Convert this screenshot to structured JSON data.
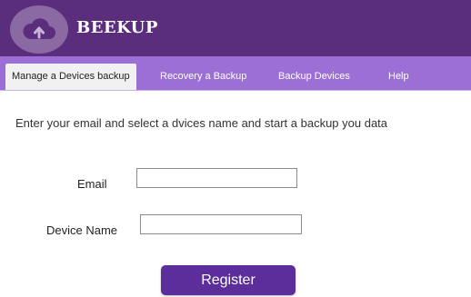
{
  "app": {
    "brand": "BEEKUP",
    "logo_icon": "cloud-upload-icon"
  },
  "tabs": [
    {
      "label": "Manage a Devices backup",
      "active": true
    },
    {
      "label": "Recovery a Backup",
      "active": false
    },
    {
      "label": "Backup Devices",
      "active": false
    },
    {
      "label": "Help",
      "active": false
    }
  ],
  "form": {
    "instructions": "Enter your email and select a dvices name and start a backup you data",
    "email_label": "Email",
    "email_value": "",
    "device_label": "Device Name",
    "device_value": "",
    "register_label": "Register"
  },
  "colors": {
    "header": "#5b2e7d",
    "tabbar": "#9b6fd6",
    "button": "#5b2e9b"
  }
}
